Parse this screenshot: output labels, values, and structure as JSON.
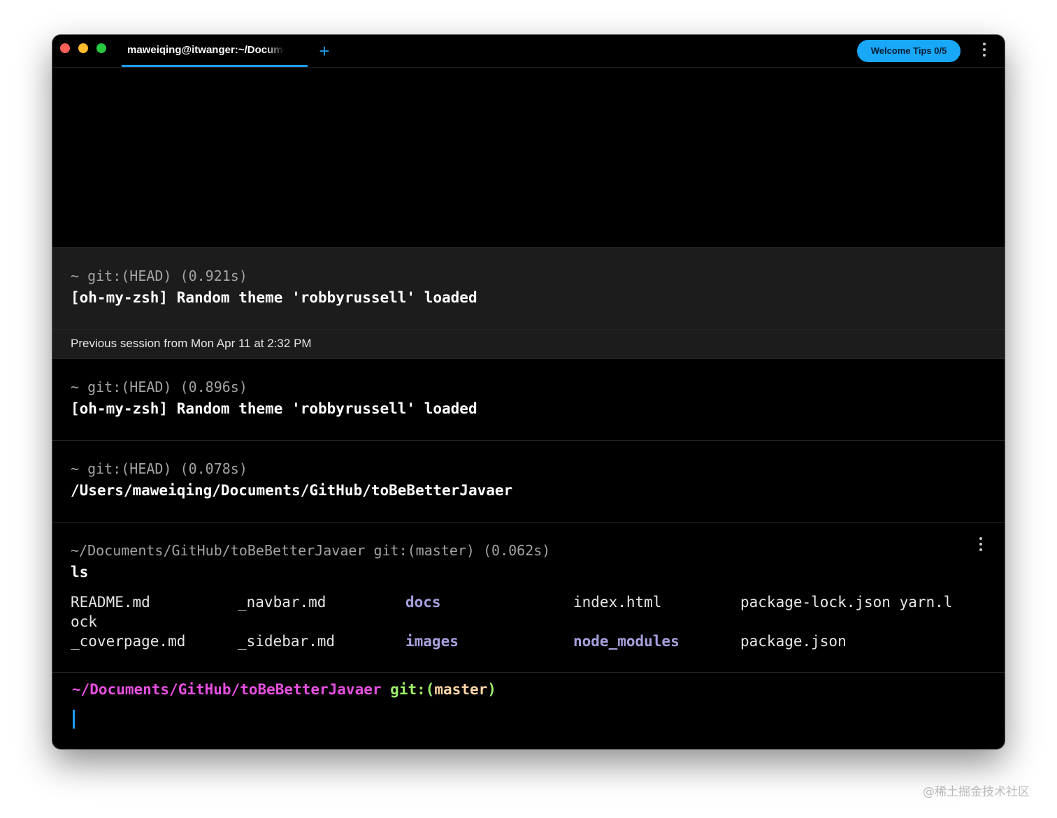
{
  "window": {
    "tab_title": "maweiqing@itwanger:~/Documents/GitHub/toBeBetterJavaer",
    "new_tab_icon": "+",
    "welcome_button": "Welcome Tips 0/5",
    "accent_color": "#1a9bf0"
  },
  "blocks": [
    {
      "meta": "~ git:(HEAD) (0.921s)",
      "command": "[oh-my-zsh] Random theme 'robbyrussell' loaded"
    },
    {
      "meta": "~ git:(HEAD) (0.896s)",
      "command": "[oh-my-zsh] Random theme 'robbyrussell' loaded"
    },
    {
      "meta": "~ git:(HEAD) (0.078s)",
      "command": "/Users/maweiqing/Documents/GitHub/toBeBetterJavaer"
    },
    {
      "meta": "~/Documents/GitHub/toBeBetterJavaer git:(master) (0.062s)",
      "command": "ls"
    }
  ],
  "session_divider": "Previous session from Mon Apr 11 at 2:32 PM",
  "ls_output": {
    "row1": [
      "README.md",
      "_navbar.md",
      "docs",
      "index.html",
      "package-lock.json yarn.l"
    ],
    "wrap": "ock",
    "row2": [
      "_coverpage.md",
      "_sidebar.md",
      "images",
      "node_modules",
      "package.json"
    ]
  },
  "prompt": {
    "path": "~/Documents/GitHub/toBeBetterJavaer",
    "git_prefix": "git:(",
    "branch": "master",
    "git_suffix": ")"
  },
  "watermark": "@稀土掘金技术社区"
}
